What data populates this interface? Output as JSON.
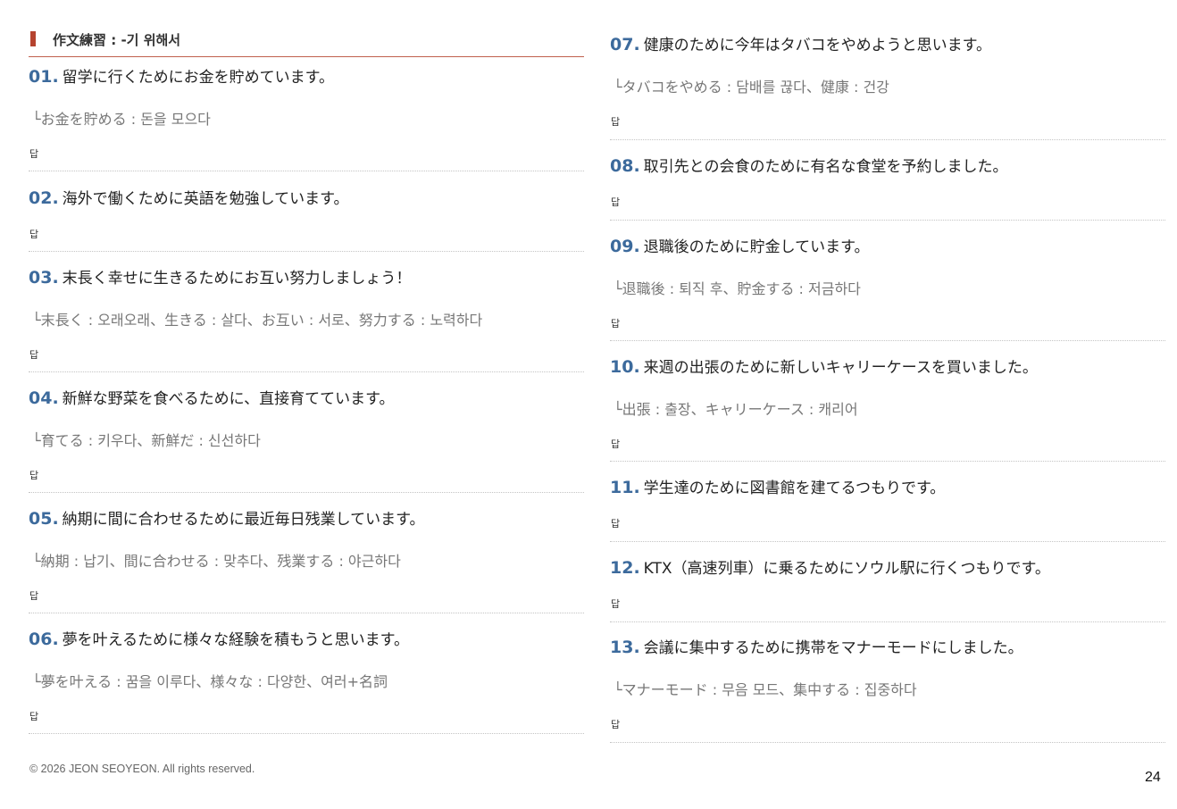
{
  "header": {
    "title": "作文練習 : -기 위해서"
  },
  "answer_label": "답",
  "left_items": [
    {
      "num": "01.",
      "question": "留学に行くためにお金を貯めています。",
      "hint": "└お金を貯める : 돈을 모으다"
    },
    {
      "num": "02.",
      "question": "海外で働くために英語を勉強しています。",
      "hint": ""
    },
    {
      "num": "03.",
      "question": "末長く幸せに生きるためにお互い努力しましょう！",
      "hint": "└末長く : 오래오래、生きる : 살다、お互い : 서로、努力する : 노력하다"
    },
    {
      "num": "04.",
      "question": "新鮮な野菜を食べるために、直接育てています。",
      "hint": "└育てる : 키우다、新鮮だ : 신선하다"
    },
    {
      "num": "05.",
      "question": "納期に間に合わせるために最近毎日残業しています。",
      "hint": "└納期 : 납기、間に合わせる : 맞추다、残業する : 야근하다"
    },
    {
      "num": "06.",
      "question": "夢を叶えるために様々な経験を積もうと思います。",
      "hint": "└夢を叶える : 꿈을 이루다、様々な : 다양한、여러+名詞"
    }
  ],
  "right_items": [
    {
      "num": "07.",
      "question": "健康のために今年はタバコをやめようと思います。",
      "hint": "└タバコをやめる : 담배를 끊다、健康 : 건강"
    },
    {
      "num": "08.",
      "question": "取引先との会食のために有名な食堂を予約しました。",
      "hint": ""
    },
    {
      "num": "09.",
      "question": "退職後のために貯金しています。",
      "hint": "└退職後 : 퇴직 후、貯金する : 저금하다"
    },
    {
      "num": "10.",
      "question": "来週の出張のために新しいキャリーケースを買いました。",
      "hint": "└出張 : 출장、キャリーケース : 캐리어"
    },
    {
      "num": "11.",
      "question": "学生達のために図書館を建てるつもりです。",
      "hint": ""
    },
    {
      "num": "12.",
      "question": "KTX（高速列車）に乗るためにソウル駅に行くつもりです。",
      "hint": ""
    },
    {
      "num": "13.",
      "question": "会議に集中するために携帯をマナーモードにしました。",
      "hint": "└マナーモード : 무음 모드、集中する : 집중하다"
    }
  ],
  "footer": {
    "copyright": "© 2026 JEON SEOYEON. All rights reserved.",
    "page_number": "24"
  }
}
